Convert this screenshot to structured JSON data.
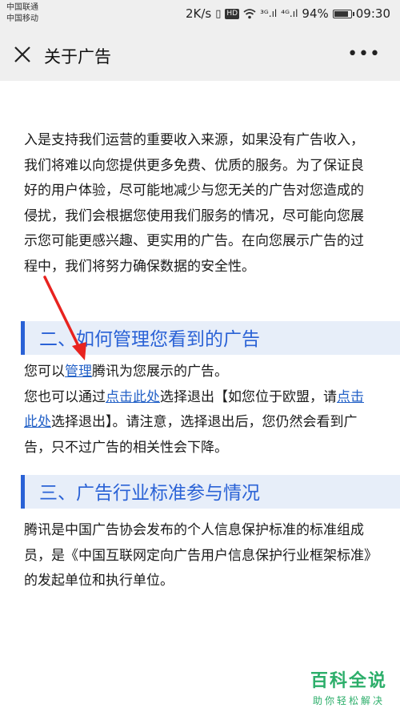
{
  "status_bar": {
    "carrier_1": "中国联通",
    "carrier_2": "中国移动",
    "speed": "2K/s",
    "hd_badge": "HD",
    "signal_1": "³ᴳ.ıl",
    "signal_2": "⁴ᴳ.ıl",
    "battery": "94%",
    "battery_level": 0.94,
    "time": "09:30"
  },
  "navbar": {
    "title": "关于广告",
    "more": "•••",
    "icons": {
      "close": "close-icon",
      "more": "more-icon"
    }
  },
  "content": {
    "intro": "入是支持我们运营的重要收入来源，如果没有广告收入，我们将难以向您提供更多免费、优质的服务。为了保证良好的用户体验，尽可能地减少与您无关的广告对您造成的侵扰，我们会根据您使用我们服务的情况，尽可能向您展示您可能更感兴趣、更实用的广告。在向您展示广告的过程中，我们将努力确保数据的安全性。",
    "section2": {
      "heading": "二、如何管理您看到的广告",
      "line1_before": "您可以",
      "line1_link": "管理",
      "line1_after": "腾讯为您展示的广告。",
      "line2_before": "您也可以通过",
      "line2_link": "点击此处",
      "line2_middle": "选择退出【如您位于欧盟，请",
      "line2_link2": "点击此处",
      "line2_after": "选择退出】。请注意，选择退出后，您仍然会看到广告，只不过广告的相关性会下降。"
    },
    "section3": {
      "heading": "三、广告行业标准参与情况",
      "text": "腾讯是中国广告协会发布的个人信息保护标准的标准组成员，是《中国互联网定向广告用户信息保护行业框架标准》的发起单位和执行单位。"
    }
  },
  "watermark": {
    "title": "百科全说",
    "subtitle": "助你轻松解决"
  },
  "colors": {
    "heading_accent": "#2a62d6",
    "heading_bg": "#e7eef9",
    "link": "#2361c7",
    "annotation_arrow": "#e8231f",
    "watermark": "#2cae6a"
  }
}
